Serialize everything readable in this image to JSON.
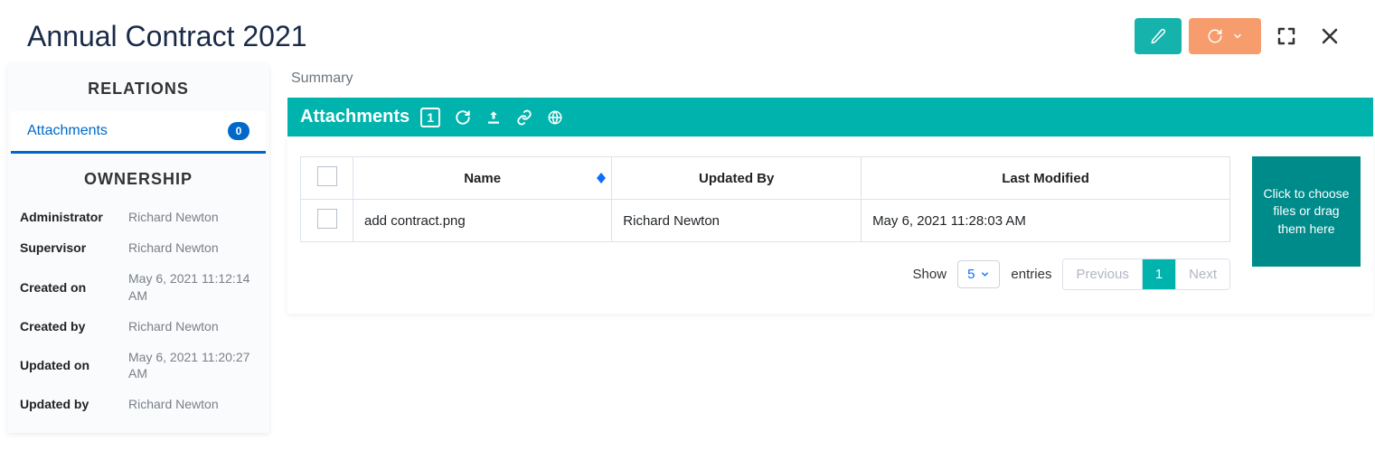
{
  "page": {
    "title": "Annual Contract 2021"
  },
  "tabs": {
    "summary": "Summary"
  },
  "sidebar": {
    "relations_title": "RELATIONS",
    "attachments_label": "Attachments",
    "attachments_count": "0",
    "ownership_title": "OWNERSHIP",
    "ownership": [
      {
        "label": "Administrator",
        "value": "Richard Newton"
      },
      {
        "label": "Supervisor",
        "value": "Richard Newton"
      },
      {
        "label": "Created on",
        "value": "May 6, 2021 11:12:14 AM"
      },
      {
        "label": "Created by",
        "value": "Richard Newton"
      },
      {
        "label": "Updated on",
        "value": "May 6, 2021 11:20:27 AM"
      },
      {
        "label": "Updated by",
        "value": "Richard Newton"
      }
    ]
  },
  "panel": {
    "title": "Attachments",
    "count": "1",
    "columns": {
      "name": "Name",
      "updated_by": "Updated By",
      "last_modified": "Last Modified"
    },
    "rows": [
      {
        "name": "add contract.png",
        "updated_by": "Richard Newton",
        "last_modified": "May 6, 2021 11:28:03 AM"
      }
    ],
    "pager": {
      "show": "Show",
      "size": "5",
      "entries": "entries",
      "previous": "Previous",
      "page": "1",
      "next": "Next"
    },
    "dropzone": "Click to choose files or drag them here"
  }
}
